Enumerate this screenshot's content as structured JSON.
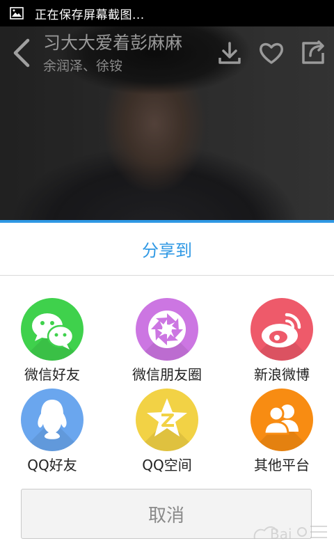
{
  "status_bar": {
    "notification_text": "正在保存屏幕截图..."
  },
  "player": {
    "song_title": "习大大爱着彭麻麻",
    "artists": "余润泽、徐铵"
  },
  "share_sheet": {
    "title": "分享到",
    "items": [
      {
        "label": "微信好友",
        "icon": "wechat-icon",
        "color": "#3fd14c"
      },
      {
        "label": "微信朋友圈",
        "icon": "moments-icon",
        "color": "#cc76e2"
      },
      {
        "label": "新浪微博",
        "icon": "weibo-icon",
        "color": "#ee5a6a"
      },
      {
        "label": "QQ好友",
        "icon": "qq-icon",
        "color": "#6aa6ee"
      },
      {
        "label": "QQ空间",
        "icon": "qzone-icon",
        "color": "#f2d245"
      },
      {
        "label": "其他平台",
        "icon": "more-platforms-icon",
        "color": "#f88c12"
      }
    ],
    "cancel_label": "取消"
  },
  "colors": {
    "accent": "#2f98e4"
  },
  "watermark": {
    "text": "Baidu 经验"
  }
}
